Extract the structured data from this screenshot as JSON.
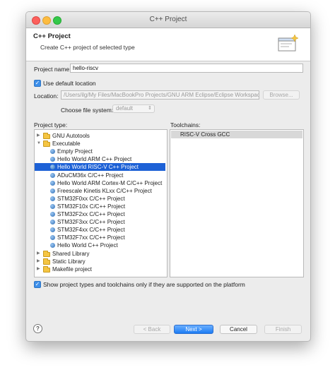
{
  "window": {
    "title": "C++ Project"
  },
  "banner": {
    "title": "C++ Project",
    "description": "Create C++ project of selected type"
  },
  "form": {
    "project_name_label": "Project name:",
    "project_name_value": "hello-riscv",
    "use_default_location_label": "Use default location",
    "use_default_location_checked": true,
    "location_label": "Location:",
    "location_value": "/Users/ilg/My Files/MacBookPro Projects/GNU ARM Eclipse/Eclipse Workspaces/s",
    "browse_label": "Browse...",
    "file_system_label": "Choose file system:",
    "file_system_value": "default"
  },
  "project_type": {
    "label": "Project type:",
    "items": [
      {
        "label": "GNU Autotools",
        "kind": "folder",
        "level": 0,
        "expanded": false,
        "selected": false
      },
      {
        "label": "Executable",
        "kind": "folder",
        "level": 0,
        "expanded": true,
        "selected": false
      },
      {
        "label": "Empty Project",
        "kind": "item",
        "level": 1,
        "selected": false
      },
      {
        "label": "Hello World ARM C++ Project",
        "kind": "item",
        "level": 1,
        "selected": false
      },
      {
        "label": "Hello World RISC-V C++ Project",
        "kind": "item",
        "level": 1,
        "selected": true
      },
      {
        "label": "ADuCM36x C/C++ Project",
        "kind": "item",
        "level": 1,
        "selected": false
      },
      {
        "label": "Hello World ARM Cortex-M C/C++ Project",
        "kind": "item",
        "level": 1,
        "selected": false
      },
      {
        "label": "Freescale Kinetis KLxx C/C++ Project",
        "kind": "item",
        "level": 1,
        "selected": false
      },
      {
        "label": "STM32F0xx C/C++ Project",
        "kind": "item",
        "level": 1,
        "selected": false
      },
      {
        "label": "STM32F10x C/C++ Project",
        "kind": "item",
        "level": 1,
        "selected": false
      },
      {
        "label": "STM32F2xx C/C++ Project",
        "kind": "item",
        "level": 1,
        "selected": false
      },
      {
        "label": "STM32F3xx C/C++ Project",
        "kind": "item",
        "level": 1,
        "selected": false
      },
      {
        "label": "STM32F4xx C/C++ Project",
        "kind": "item",
        "level": 1,
        "selected": false
      },
      {
        "label": "STM32F7xx C/C++ Project",
        "kind": "item",
        "level": 1,
        "selected": false
      },
      {
        "label": "Hello World C++ Project",
        "kind": "item",
        "level": 1,
        "selected": false
      },
      {
        "label": "Shared Library",
        "kind": "folder",
        "level": 0,
        "expanded": false,
        "selected": false
      },
      {
        "label": "Static Library",
        "kind": "folder",
        "level": 0,
        "expanded": false,
        "selected": false
      },
      {
        "label": "Makefile project",
        "kind": "folder",
        "level": 0,
        "expanded": false,
        "selected": false
      }
    ]
  },
  "toolchains": {
    "label": "Toolchains:",
    "items": [
      {
        "label": "RISC-V Cross GCC",
        "selected": true
      }
    ]
  },
  "show_supported": {
    "label": "Show project types and toolchains only if they are supported on the platform",
    "checked": true
  },
  "footer": {
    "help_label": "?",
    "back_label": "< Back",
    "next_label": "Next >",
    "cancel_label": "Cancel",
    "finish_label": "Finish"
  },
  "colors": {
    "selection": "#1d61d6",
    "primary_button": "#1c7cf4",
    "checkbox": "#3d8fea"
  },
  "icons": {
    "help": "help-icon",
    "folder": "folder-icon",
    "project_type": "project-type-icon",
    "wizard_banner": "wizard-banner-icon"
  }
}
